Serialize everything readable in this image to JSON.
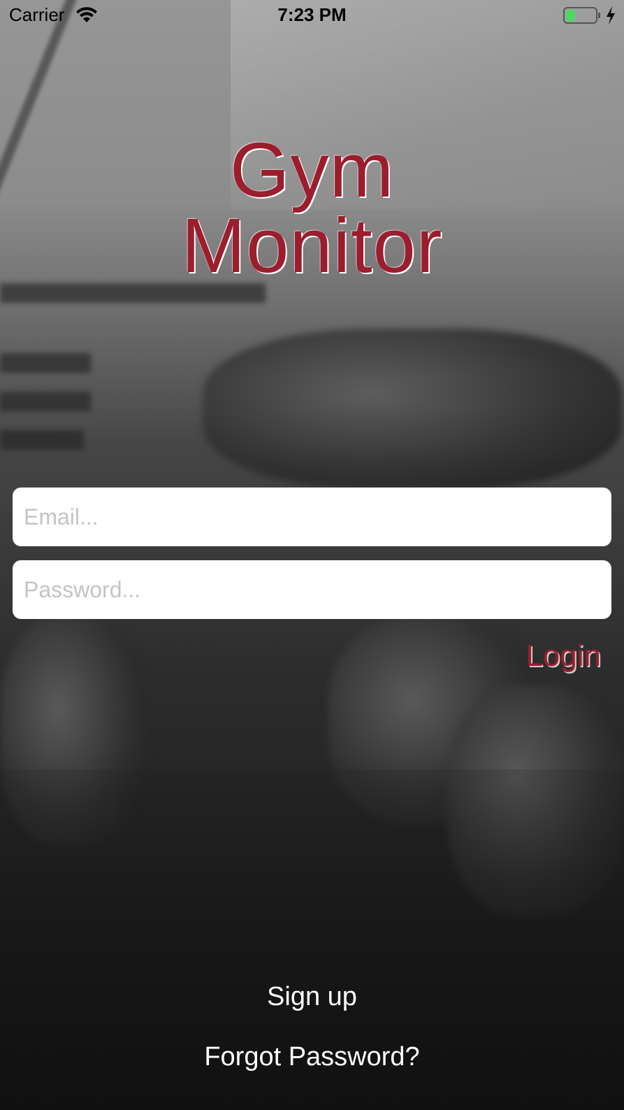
{
  "status_bar": {
    "carrier": "Carrier",
    "time": "7:23 PM",
    "battery_color": "#4cd964",
    "icons": [
      "wifi-icon",
      "battery-icon",
      "charging-bolt-icon"
    ]
  },
  "title": {
    "line1": "Gym",
    "line2": "Monitor",
    "color": "#9b1d2e"
  },
  "form": {
    "email_placeholder": "Email...",
    "email_value": "",
    "password_placeholder": "Password...",
    "password_value": "",
    "login_label": "Login"
  },
  "links": {
    "signup_label": "Sign up",
    "forgot_label": "Forgot Password?"
  }
}
